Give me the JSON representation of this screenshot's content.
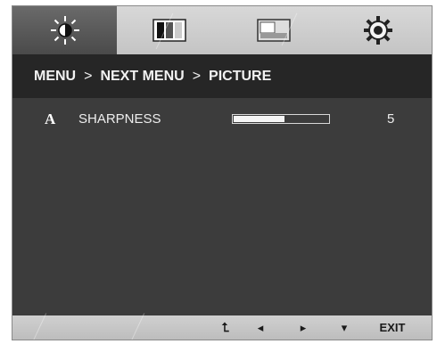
{
  "tabs": [
    {
      "icon": "brightness-sun-icon",
      "active": true
    },
    {
      "icon": "color-bars-icon",
      "active": false
    },
    {
      "icon": "display-layout-icon",
      "active": false
    },
    {
      "icon": "settings-gear-icon",
      "active": false
    }
  ],
  "breadcrumb": {
    "menu": "MENU",
    "sep1": ">",
    "next_menu": "NEXT MENU",
    "sep2": ">",
    "current": "PICTURE"
  },
  "settings": {
    "sharpness": {
      "icon_glyph": "A",
      "label": "SHARPNESS",
      "value": "5",
      "level_fraction": 0.55
    }
  },
  "footer": {
    "buttons": [
      {
        "glyph": "⮤",
        "name": "back-icon"
      },
      {
        "glyph": "◂",
        "name": "left-arrow-icon"
      },
      {
        "glyph": "▸",
        "name": "right-arrow-icon"
      },
      {
        "glyph": "▾",
        "name": "down-arrow-icon"
      }
    ],
    "exit_label": "EXIT"
  }
}
